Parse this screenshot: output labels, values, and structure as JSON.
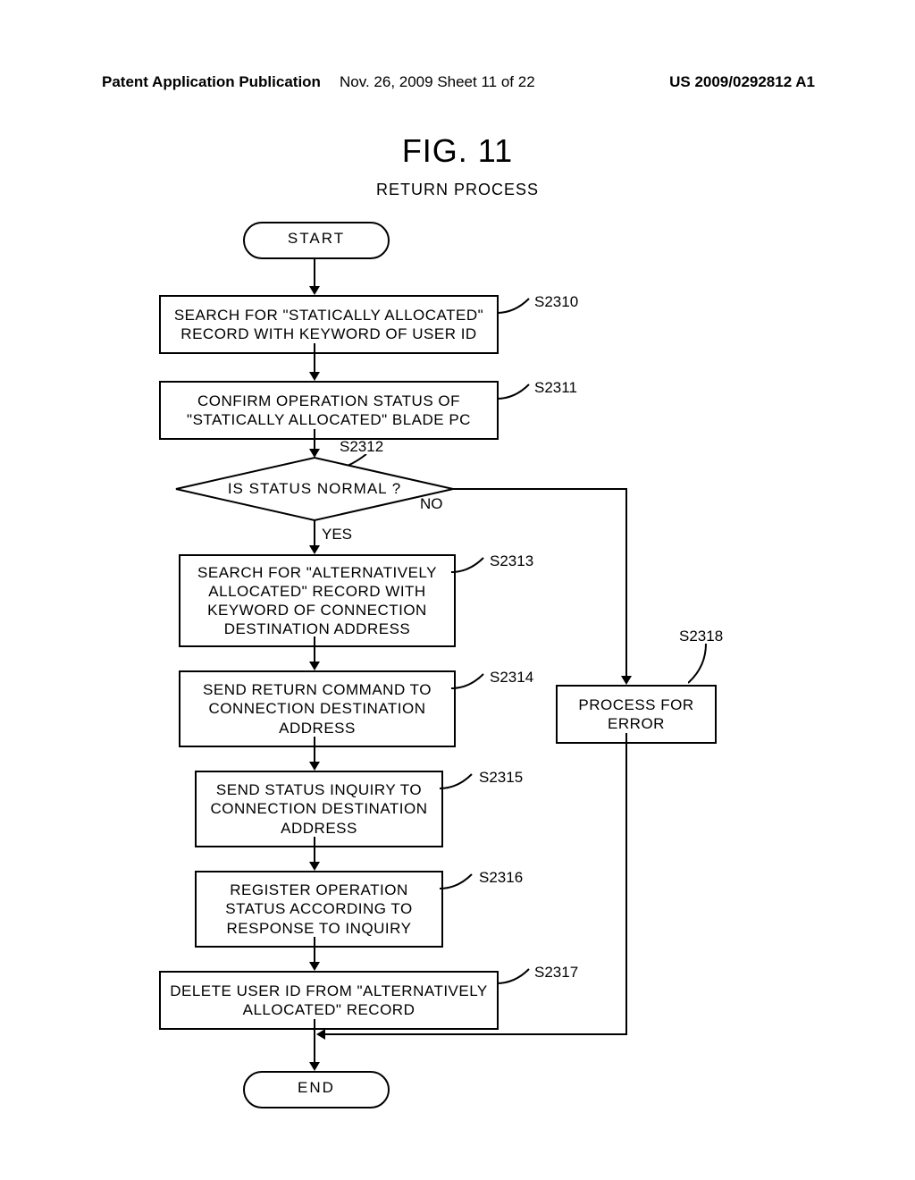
{
  "header": {
    "left": "Patent Application Publication",
    "middle": "Nov. 26, 2009  Sheet 11 of 22",
    "right": "US 2009/0292812 A1"
  },
  "figure": {
    "title": "FIG. 11",
    "subtitle": "RETURN PROCESS"
  },
  "nodes": {
    "start": "START",
    "end": "END",
    "s2310": "SEARCH FOR \"STATICALLY ALLOCATED\" RECORD WITH KEYWORD OF USER ID",
    "s2311": "CONFIRM OPERATION STATUS OF \"STATICALLY ALLOCATED\" BLADE PC",
    "s2312": "IS STATUS NORMAL ?",
    "s2313": "SEARCH FOR \"ALTERNATIVELY ALLOCATED\" RECORD WITH KEYWORD OF CONNECTION DESTINATION ADDRESS",
    "s2314": "SEND RETURN COMMAND TO CONNECTION DESTINATION ADDRESS",
    "s2315": "SEND STATUS INQUIRY TO CONNECTION DESTINATION ADDRESS",
    "s2316": "REGISTER OPERATION STATUS ACCORDING TO RESPONSE TO INQUIRY",
    "s2317": "DELETE USER ID FROM \"ALTERNATIVELY ALLOCATED\" RECORD",
    "s2318": "PROCESS FOR ERROR"
  },
  "step_labels": {
    "s2310": "S2310",
    "s2311": "S2311",
    "s2312": "S2312",
    "s2313": "S2313",
    "s2314": "S2314",
    "s2315": "S2315",
    "s2316": "S2316",
    "s2317": "S2317",
    "s2318": "S2318"
  },
  "decision_labels": {
    "yes": "YES",
    "no": "NO"
  },
  "chart_data": {
    "type": "flowchart",
    "title": "RETURN PROCESS",
    "nodes": [
      {
        "id": "start",
        "type": "terminator",
        "label": "START"
      },
      {
        "id": "S2310",
        "type": "process",
        "label": "SEARCH FOR \"STATICALLY ALLOCATED\" RECORD WITH KEYWORD OF USER ID"
      },
      {
        "id": "S2311",
        "type": "process",
        "label": "CONFIRM OPERATION STATUS OF \"STATICALLY ALLOCATED\" BLADE PC"
      },
      {
        "id": "S2312",
        "type": "decision",
        "label": "IS STATUS NORMAL ?"
      },
      {
        "id": "S2313",
        "type": "process",
        "label": "SEARCH FOR \"ALTERNATIVELY ALLOCATED\" RECORD WITH KEYWORD OF CONNECTION DESTINATION ADDRESS"
      },
      {
        "id": "S2314",
        "type": "process",
        "label": "SEND RETURN COMMAND TO CONNECTION DESTINATION ADDRESS"
      },
      {
        "id": "S2315",
        "type": "process",
        "label": "SEND STATUS INQUIRY TO CONNECTION DESTINATION ADDRESS"
      },
      {
        "id": "S2316",
        "type": "process",
        "label": "REGISTER OPERATION STATUS ACCORDING TO RESPONSE TO INQUIRY"
      },
      {
        "id": "S2317",
        "type": "process",
        "label": "DELETE USER ID FROM \"ALTERNATIVELY ALLOCATED\" RECORD"
      },
      {
        "id": "S2318",
        "type": "process",
        "label": "PROCESS FOR ERROR"
      },
      {
        "id": "end",
        "type": "terminator",
        "label": "END"
      }
    ],
    "edges": [
      {
        "from": "start",
        "to": "S2310"
      },
      {
        "from": "S2310",
        "to": "S2311"
      },
      {
        "from": "S2311",
        "to": "S2312"
      },
      {
        "from": "S2312",
        "to": "S2313",
        "label": "YES"
      },
      {
        "from": "S2312",
        "to": "S2318",
        "label": "NO"
      },
      {
        "from": "S2313",
        "to": "S2314"
      },
      {
        "from": "S2314",
        "to": "S2315"
      },
      {
        "from": "S2315",
        "to": "S2316"
      },
      {
        "from": "S2316",
        "to": "S2317"
      },
      {
        "from": "S2317",
        "to": "end"
      },
      {
        "from": "S2318",
        "to": "end"
      }
    ]
  }
}
